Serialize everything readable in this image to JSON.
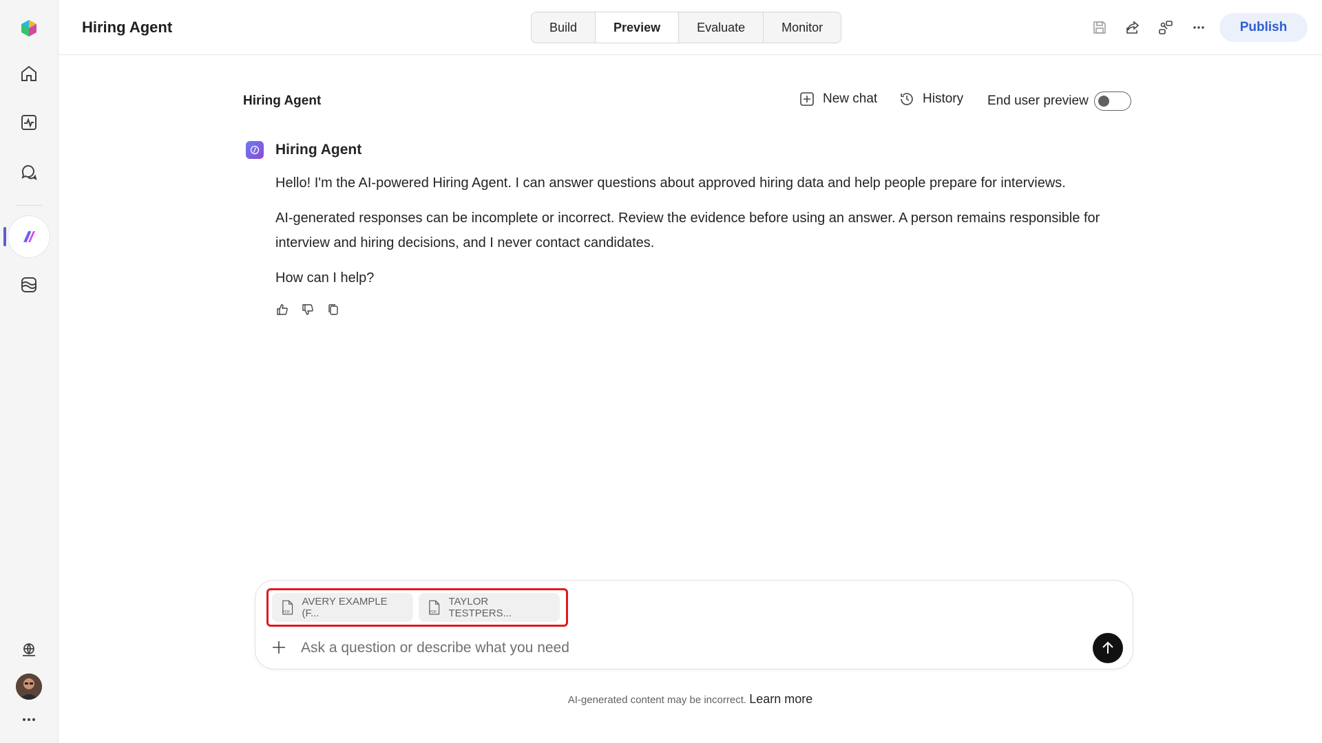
{
  "app": {
    "title": "Hiring Agent"
  },
  "tabs": [
    {
      "label": "Build"
    },
    {
      "label": "Preview",
      "active": true
    },
    {
      "label": "Evaluate"
    },
    {
      "label": "Monitor"
    }
  ],
  "header_actions": {
    "publish_label": "Publish",
    "icons": [
      "save-icon",
      "share-icon",
      "connect-icon",
      "more-icon"
    ]
  },
  "rail": {
    "icons": [
      "copilot-logo",
      "home-icon",
      "activity-icon",
      "chat-icon",
      "agent-icon",
      "library-icon",
      "environment-icon",
      "avatar",
      "more-icon"
    ]
  },
  "chat": {
    "title": "Hiring Agent",
    "new_chat_label": "New chat",
    "history_label": "History",
    "end_user_preview_label": "End user preview",
    "end_user_preview_on": false
  },
  "message": {
    "sender": "Hiring Agent",
    "paragraphs": [
      "Hello! I'm the AI-powered Hiring Agent. I can answer questions about approved hiring data and help people prepare for interviews.",
      "AI-generated responses can be incomplete or incorrect. Review the evidence before using an answer. A person remains responsible for interview and hiring decisions, and I never contact candidates.",
      "How can I help?"
    ]
  },
  "composer": {
    "attachments": [
      {
        "name": "AVERY EXAMPLE (F...",
        "type": "pdf"
      },
      {
        "name": "TAYLOR TESTPERS...",
        "type": "pdf"
      }
    ],
    "placeholder": "Ask a question or describe what you need"
  },
  "footer": {
    "disclaimer": "AI-generated content may be incorrect.",
    "link": "Learn more"
  },
  "colors": {
    "accent": "#5b5fc7",
    "publish_text": "#2f5fd0",
    "publish_bg": "#ebf0fb",
    "highlight": "#e0191e",
    "send_bg": "#111111"
  }
}
